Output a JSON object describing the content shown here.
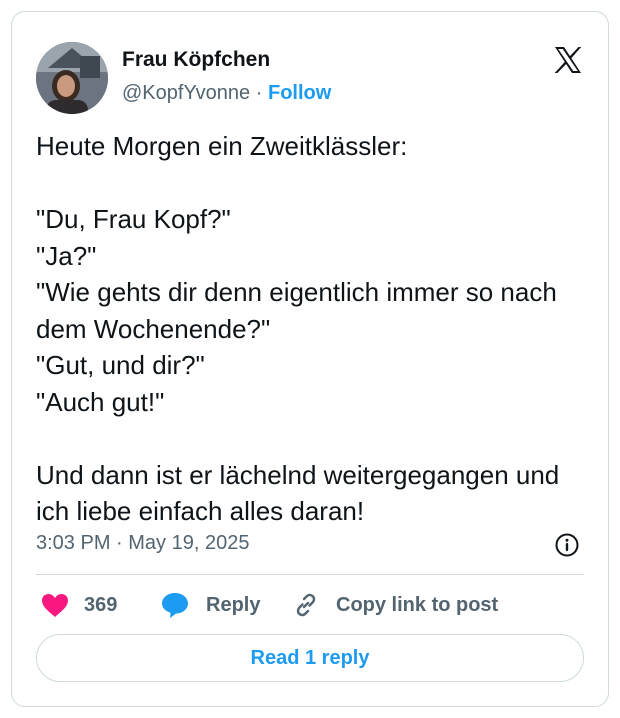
{
  "author": {
    "name": "Frau Köpfchen",
    "handle": "@KopfYvonne",
    "separator": "·",
    "follow_label": "Follow"
  },
  "tweet": {
    "paragraphs": [
      "Heute Morgen ein Zweitklässler:",
      "\"Du, Frau Kopf?\"\n\"Ja?\"\n\"Wie gehts dir denn eigentlich immer so nach dem Wochenende?\"\n\"Gut, und dir?\"\n\"Auch gut!\"",
      "Und dann ist er lächelnd weitergegangen und ich liebe einfach alles daran!"
    ],
    "timestamp": "3:03 PM · May 19, 2025"
  },
  "actions": {
    "like_count": "369",
    "reply_label": "Reply",
    "copy_link_label": "Copy link to post"
  },
  "read_replies_label": "Read 1 reply",
  "icons": {
    "logo": "x-logo-icon",
    "info": "info-icon",
    "like": "heart-icon",
    "reply": "speech-bubble-icon",
    "copy": "link-icon"
  },
  "colors": {
    "accent": "#1d9bf0",
    "like": "#f91880",
    "text": "#0f1419",
    "secondary": "#536471",
    "border": "#cfd9de"
  }
}
